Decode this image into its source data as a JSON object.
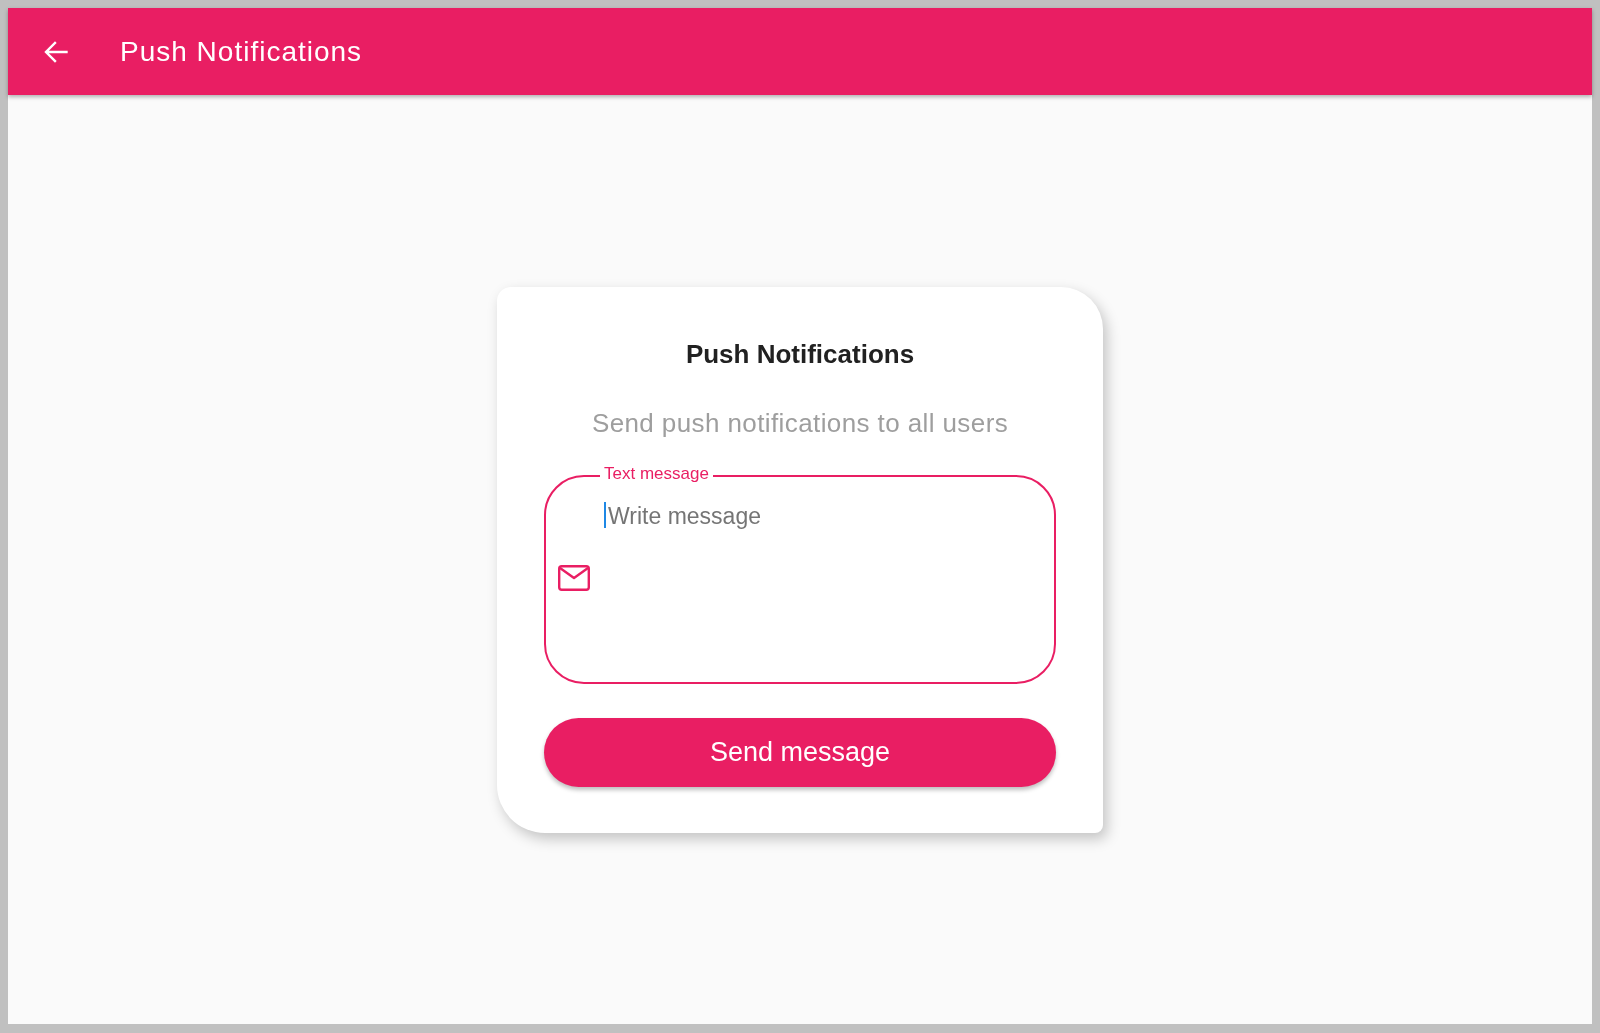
{
  "app_bar": {
    "title": "Push Notifications"
  },
  "card": {
    "title": "Push Notifications",
    "subtitle": "Send push notifications to all users",
    "message_field": {
      "label": "Text message",
      "placeholder": "Write message",
      "focused": true
    },
    "send_button": {
      "label": "Send message"
    }
  }
}
